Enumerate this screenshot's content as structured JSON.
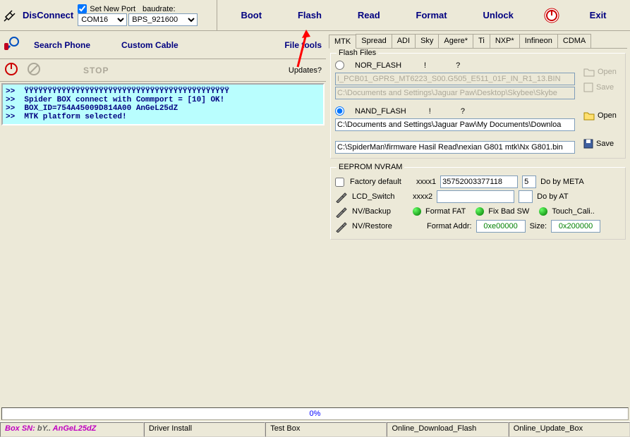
{
  "top": {
    "disconnect": "DisConnect",
    "setNewPort": "Set New Port",
    "baudrate": "baudrate:",
    "port": "COM16",
    "baud": "BPS_921600",
    "nav": [
      "Boot",
      "Flash",
      "Read",
      "Format",
      "Unlock",
      "Exit"
    ]
  },
  "mid": {
    "searchPhone": "Search Phone",
    "customCable": "Custom Cable",
    "fileTools": "File tools",
    "stop": "STOP",
    "updates": "Updates?"
  },
  "log": ">>  ŸŸŸŸŸŸŸŸŸŸŸŸŸŸŸŸŸŸŸŸŸŸŸŸŸŸŸŸŸŸŸŸŸŸŸŸŸŸŸŸŸŸŸŸ\n>>  Spider BOX connect with Commport = [10] OK!\n>>  BOX_ID=754A45009D814A00 AnGeL25dZ\n>>  MTK platform selected!",
  "tabs": [
    "MTK",
    "Spread",
    "ADI",
    "Sky",
    "Agere*",
    "Ti",
    "NXP*",
    "Infineon",
    "CDMA"
  ],
  "flashFiles": {
    "title": "Flash Files",
    "nor": "NOR_FLASH",
    "nand": "NAND_FLASH",
    "q1": "!",
    "q2": "?",
    "path1": "I_PCB01_GPRS_MT6223_S00.G505_E511_01F_IN_R1_13.BIN",
    "path2": "C:\\Documents and Settings\\Jaguar Paw\\Desktop\\Skybee\\Skybe",
    "path3": "C:\\Documents and Settings\\Jaguar Paw\\My Documents\\Downloa",
    "path4": "C:\\SpiderMan\\firmware Hasil Read\\nexian G801 mtk\\Nx G801.bin",
    "open": "Open",
    "save": "Save"
  },
  "eeprom": {
    "title": "EEPROM NVRAM",
    "factoryDefault": "Factory default",
    "xxxx1": "xxxx1",
    "xxxx2": "xxxx2",
    "val1": "35752003377118",
    "val1b": "5",
    "val2": "",
    "val2b": "",
    "doMeta": "Do by META",
    "doAt": "Do by AT",
    "lcdSwitch": "LCD_Switch",
    "nvBackup": "NV/Backup",
    "nvRestore": "NV/Restore",
    "formatFat": "Format FAT",
    "fixBad": "Fix Bad SW",
    "touchCali": "Touch_Cali..",
    "formatAddr": "Format Addr:",
    "addr": "0xe00000",
    "size": "Size:",
    "sizeVal": "0x200000"
  },
  "progress": "0%",
  "status": {
    "sn_pre": "Box SN:",
    "sn_by": "bY..",
    "sn_val": "AnGeL25dZ",
    "driver": "Driver Install",
    "test": "Test Box",
    "online1": "Online_Download_Flash",
    "online2": "Online_Update_Box"
  }
}
